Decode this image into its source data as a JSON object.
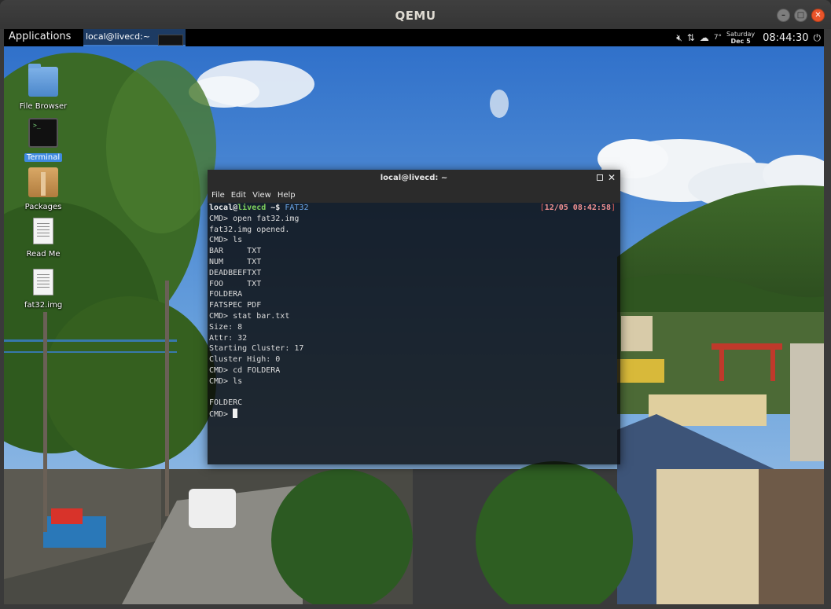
{
  "qemu": {
    "title": "QEMU",
    "buttons": [
      "minimize",
      "maximize",
      "close"
    ]
  },
  "panel": {
    "applications_label": "Applications",
    "task_label": "local@livecd:~",
    "tray": {
      "temperature": "7°",
      "day": "Saturday",
      "date": "Dec 5",
      "time": "08:44:30"
    }
  },
  "desktop_icons": [
    {
      "label": "File Browser",
      "icon": "folder-icon"
    },
    {
      "label": "Terminal",
      "icon": "terminal-icon",
      "selected": true
    },
    {
      "label": "Packages",
      "icon": "package-icon"
    },
    {
      "label": "Read Me",
      "icon": "document-icon"
    },
    {
      "label": "fat32.img",
      "icon": "document-icon"
    }
  ],
  "terminal": {
    "title": "local@livecd: ~",
    "menu": [
      "File",
      "Edit",
      "View",
      "Help"
    ],
    "prompt": {
      "user": "local",
      "at": "@",
      "host": "livecd",
      "path": " ~$ ",
      "command": "FAT32",
      "timestamp_open": "[",
      "timestamp": "12/05 08:42:58",
      "timestamp_close": "]"
    },
    "lines": [
      "CMD> open fat32.img",
      "fat32.img opened.",
      "CMD> ls",
      "BAR     TXT",
      "NUM     TXT",
      "DEADBEEFTXT",
      "FOO     TXT",
      "FOLDERA",
      "FATSPEC PDF",
      "CMD> stat bar.txt",
      "Size: 8",
      "Attr: 32",
      "Starting Cluster: 17",
      "Cluster High: 0",
      "CMD> cd FOLDERA",
      "CMD> ls",
      "",
      "FOLDERC"
    ],
    "final_prompt": "CMD> "
  },
  "colors": {
    "panel_bg": "#000000",
    "selection": "#3f8ae0",
    "prompt_host": "#7fd35d",
    "prompt_cmd": "#6aa6e8",
    "timestamp": "#e0605a",
    "close_button": "#e9542a"
  }
}
